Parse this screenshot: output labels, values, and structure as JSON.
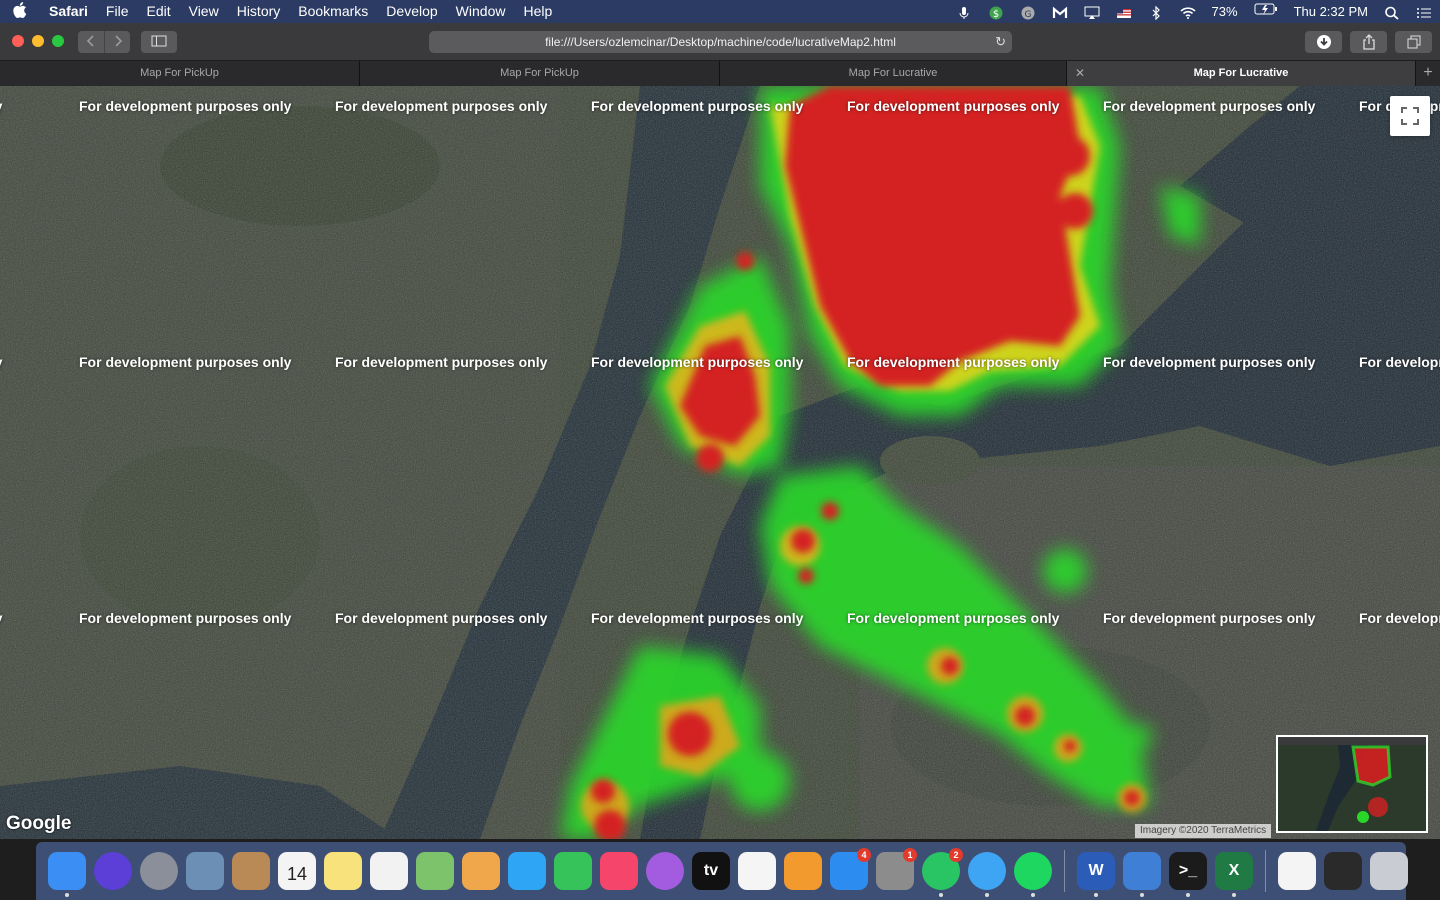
{
  "menubar": {
    "app_name": "Safari",
    "items": [
      "File",
      "Edit",
      "View",
      "History",
      "Bookmarks",
      "Develop",
      "Window",
      "Help"
    ],
    "battery": "73%",
    "clock": "Thu 2:32 PM"
  },
  "toolbar": {
    "url": "file:///Users/ozlemcinar/Desktop/machine/code/lucrativeMap2.html"
  },
  "tabs": [
    {
      "label": "Map For PickUp",
      "active": false
    },
    {
      "label": "Map For PickUp",
      "active": false
    },
    {
      "label": "Map For Lucrative",
      "active": false
    },
    {
      "label": "Map For Lucrative",
      "active": true
    }
  ],
  "map": {
    "watermark": "For development purposes only",
    "logo": "Google",
    "attribution": "Imagery ©2020 TerraMetrics"
  },
  "dock": {
    "icons": [
      {
        "name": "finder-icon",
        "color": "#3b8ef3",
        "running": true
      },
      {
        "name": "siri-icon",
        "color": "#5b3fd6",
        "running": false
      },
      {
        "name": "launchpad-icon",
        "color": "#8a8f99",
        "running": false
      },
      {
        "name": "mail-stamp-icon",
        "color": "#6b8fb5",
        "running": false
      },
      {
        "name": "contacts-icon",
        "color": "#b98a55",
        "running": false
      },
      {
        "name": "calendar-icon",
        "color": "#f4f4f4",
        "running": false,
        "label": "14"
      },
      {
        "name": "notes-icon",
        "color": "#f7e27b",
        "running": false
      },
      {
        "name": "reminders-icon",
        "color": "#f2f2f2",
        "running": false
      },
      {
        "name": "maps-icon",
        "color": "#7cc36b",
        "running": false
      },
      {
        "name": "photos-icon",
        "color": "#f0a64b",
        "running": false
      },
      {
        "name": "messages-icon",
        "color": "#2fa5f5",
        "running": false
      },
      {
        "name": "facetime-icon",
        "color": "#36c45a",
        "running": false
      },
      {
        "name": "music-icon",
        "color": "#f6456a",
        "running": false
      },
      {
        "name": "podcasts-icon",
        "color": "#a35ce0",
        "running": false
      },
      {
        "name": "appletv-icon",
        "color": "#111111",
        "running": false,
        "label": "tv"
      },
      {
        "name": "news-icon",
        "color": "#f5f5f5",
        "running": false
      },
      {
        "name": "books-icon",
        "color": "#f29a2e",
        "running": false
      },
      {
        "name": "appstore-icon",
        "color": "#2d8cf0",
        "running": false,
        "badge": "4"
      },
      {
        "name": "system-preferences-icon",
        "color": "#8c8c8c",
        "running": false,
        "badge": "1"
      },
      {
        "name": "whatsapp-icon",
        "color": "#29c463",
        "running": true,
        "badge": "2"
      },
      {
        "name": "safari-icon",
        "color": "#3ea5f4",
        "running": true
      },
      {
        "name": "spotify-icon",
        "color": "#1ed760",
        "running": true
      },
      {
        "name": "word-icon",
        "color": "#2b5cb8",
        "running": true,
        "label": "W"
      },
      {
        "name": "xcode-icon",
        "color": "#3f7fd6",
        "running": true
      },
      {
        "name": "terminal-icon",
        "color": "#1b1b1b",
        "running": true,
        "label": ">_"
      },
      {
        "name": "excel-icon",
        "color": "#1f7a43",
        "running": true,
        "label": "X"
      },
      {
        "name": "document-icon",
        "color": "#f4f4f4",
        "running": false
      },
      {
        "name": "screen-window-icon",
        "color": "#2a2a2a",
        "running": false
      },
      {
        "name": "trash-icon",
        "color": "#c9ccd2",
        "running": false
      }
    ]
  }
}
